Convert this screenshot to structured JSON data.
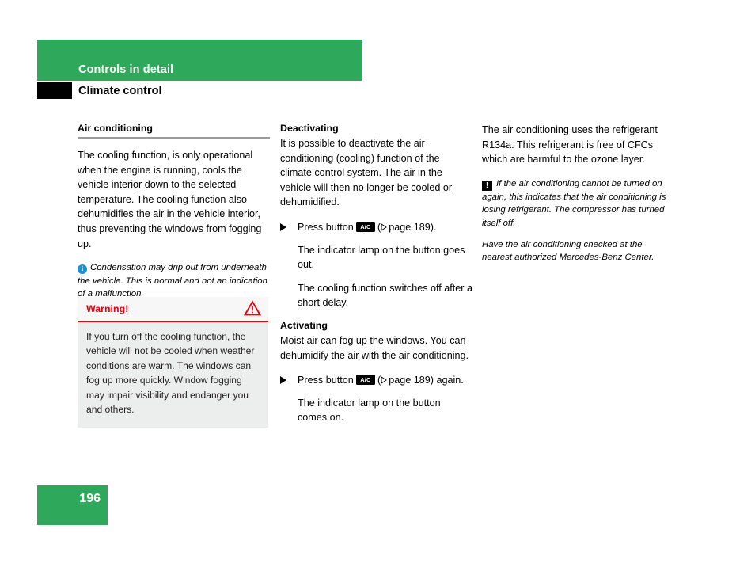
{
  "header": {
    "chapter": "Controls in detail",
    "section": "Climate control"
  },
  "columns": {
    "left": {
      "heading": "Air conditioning",
      "paragraph": "The cooling function, is only operational when the engine is running, cools the vehicle interior down to the selected temperature. The cooling function also dehumidifies the air in the vehicle interior, thus preventing the windows from fogging up.",
      "note_icon": "info-icon",
      "note_icon_glyph": "i",
      "note": "Condensation may drip out from underneath the vehicle. This is normal and not an indication of a malfunction.",
      "warning": {
        "title": "Warning!",
        "icon": "warning-triangle-icon",
        "body": "If you turn off the cooling function, the vehicle will not be cooled when weather conditions are warm. The windows can fog up more quickly. Window fogging may impair visibility and endanger you and others."
      }
    },
    "middle": {
      "deactivating": {
        "heading": "Deactivating",
        "paragraph": "It is possible to deactivate the air conditioning (cooling) function of the climate control system. The air in the vehicle will then no longer be cooled or dehumidified.",
        "step_prefix": "Press button",
        "button_label": "A/C",
        "step_suffix": "(",
        "page_ref": "page 189",
        "step_end": ").",
        "result_1": "The indicator lamp on the button goes out.",
        "result_2": "The cooling function switches off after a short delay."
      },
      "activating": {
        "heading": "Activating",
        "paragraph": "Moist air can fog up the windows. You can dehumidify the air with the air conditioning.",
        "step_prefix": "Press button",
        "button_label": "A/C",
        "page_ref": "page 189",
        "step_end": ") again.",
        "result_1": "The indicator lamp on the button comes on."
      }
    },
    "right": {
      "paragraph": "The air conditioning uses the refrigerant R134a. This refrigerant is free of CFCs which are harmful to the ozone layer.",
      "caution_icon": "caution-exclamation-icon",
      "caution_icon_glyph": "!",
      "caution": "If the air conditioning cannot be turned on again, this indicates that the air conditioning is losing refrigerant. The compressor has turned itself off.",
      "followup": "Have the air conditioning checked at the nearest authorized Mercedes-Benz Center."
    }
  },
  "footer": {
    "page_number": "196"
  },
  "colors": {
    "brand_green": "#2ea85a",
    "warning_red": "#e8000d",
    "info_blue": "#1b8fd4",
    "rule_gray": "#9b9b9b",
    "box_gray": "#eceded"
  }
}
